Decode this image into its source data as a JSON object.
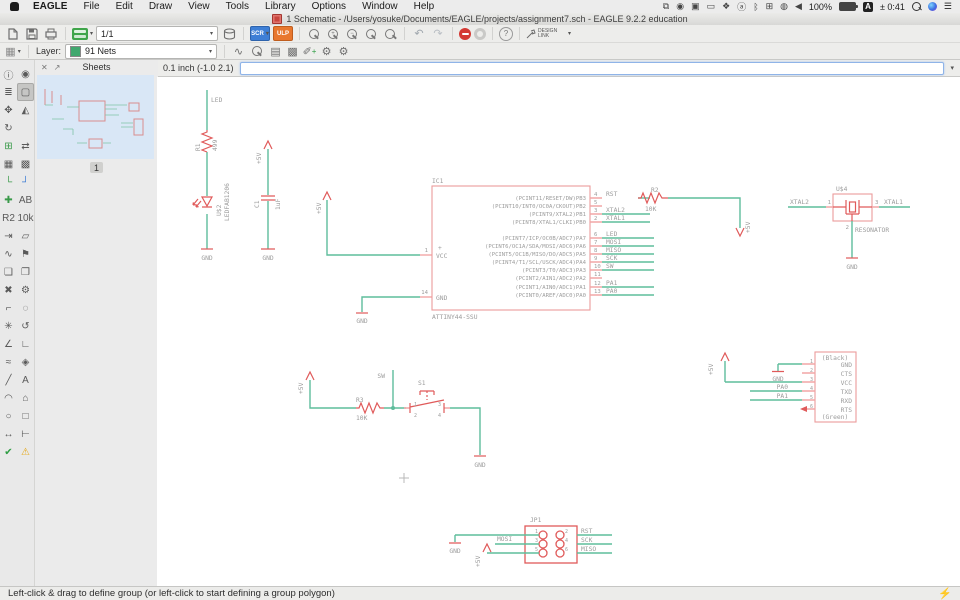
{
  "menu_bar": {
    "items": [
      "EAGLE",
      "File",
      "Edit",
      "Draw",
      "View",
      "Tools",
      "Library",
      "Options",
      "Window",
      "Help"
    ],
    "status_icons": [
      {
        "name": "display-mirroring-icon",
        "glyph": "⧉"
      },
      {
        "name": "camera-icon",
        "glyph": "◉"
      },
      {
        "name": "obs-icon",
        "glyph": "▣"
      },
      {
        "name": "monitor-icon",
        "glyph": "▭"
      },
      {
        "name": "dropbox-icon",
        "glyph": "❖"
      },
      {
        "name": "circled-a-icon",
        "glyph": "ⓐ"
      },
      {
        "name": "bluetooth-icon",
        "glyph": "ᛒ"
      },
      {
        "name": "window-manager-icon",
        "glyph": "⊞"
      },
      {
        "name": "screen-record-icon",
        "glyph": "◍"
      },
      {
        "name": "volume-icon",
        "glyph": "◀"
      }
    ],
    "battery_percent": "100%",
    "input_source": "A",
    "timer": "± 0:41",
    "notification_list_icon": "☰"
  },
  "title_bar": {
    "title": "1 Schematic - /Users/yosuke/Documents/EAGLE/projects/assignment7.sch - EAGLE 9.2.2 education"
  },
  "toolbar_main": {
    "sheet_selector": "1/1",
    "scr_label": "SCR",
    "ulp_label": "ULP",
    "zoom_in_glyph": "+",
    "zoom_out_glyph": "−",
    "undo_glyph": "↶",
    "redo_glyph": "↷",
    "help_label": "?",
    "design_link_label": "DESIGN LINK"
  },
  "toolbar_layer": {
    "label": "Layer:",
    "selected_layer": "91 Nets",
    "swatch_color": "#41A86F",
    "icons": [
      "∿",
      "▤",
      "▩",
      "✐",
      "⚙",
      "⚙"
    ]
  },
  "command_bar": {
    "grid_coords": "0.1 inch (-1.0 2.1)",
    "command_input_value": ""
  },
  "sheets_panel": {
    "title": "Sheets",
    "sheet_number": "1"
  },
  "palette": {
    "items": [
      {
        "n": "info-tool-icon",
        "g": "ⓘ"
      },
      {
        "n": "eye-show-tool-icon",
        "g": "◉"
      },
      {
        "n": "display-layers-tool-icon",
        "g": "≣"
      },
      {
        "n": "group-select-tool-icon",
        "g": "▢",
        "active": true
      },
      {
        "n": "move-tool-icon",
        "g": "✥"
      },
      {
        "n": "mirror-tool-icon",
        "g": "◭"
      },
      {
        "n": "rotate-tool-icon",
        "g": "↻"
      },
      {
        "n": "palette-spacer",
        "g": ""
      },
      {
        "n": "add-part-tool-icon",
        "g": "⊞",
        "c": "#3A9A4A"
      },
      {
        "n": "pinswap-tool-icon",
        "g": "⇄"
      },
      {
        "n": "replace-tool-icon",
        "g": "▦"
      },
      {
        "n": "gateswap-tool-icon",
        "g": "▩"
      },
      {
        "n": "wire-bend-1-tool-icon",
        "g": "└",
        "c": "#3A9A4A"
      },
      {
        "n": "wire-bend-2-tool-icon",
        "g": "┘",
        "c": "#3B7BD4"
      },
      {
        "n": "junction-tool-icon",
        "g": "✚",
        "c": "#3A9A4A"
      },
      {
        "n": "label-tool-icon",
        "g": "AB"
      },
      {
        "n": "name-tool-icon",
        "g": "R2"
      },
      {
        "n": "value-tool-icon",
        "g": "10k"
      },
      {
        "n": "invoke-tool-icon",
        "g": "⇥"
      },
      {
        "n": "polygon-tool-icon",
        "g": "▱"
      },
      {
        "n": "bus-tool-icon",
        "g": "∿"
      },
      {
        "n": "attribute-tool-icon",
        "g": "⚑"
      },
      {
        "n": "copy-tool-icon",
        "g": "❏"
      },
      {
        "n": "paste-tool-icon",
        "g": "❐"
      },
      {
        "n": "delete-tool-icon",
        "g": "✖"
      },
      {
        "n": "change-wrench-tool-icon",
        "g": "⚙"
      },
      {
        "n": "route-tool-icon",
        "g": "⌐"
      },
      {
        "n": "ripup-tool-icon",
        "g": "◌"
      },
      {
        "n": "smash-tool-icon",
        "g": "✳"
      },
      {
        "n": "copy-group-tool-icon",
        "g": "↺"
      },
      {
        "n": "split-tool-icon",
        "g": "∠"
      },
      {
        "n": "miter-tool-icon",
        "g": "∟"
      },
      {
        "n": "meander-tool-icon",
        "g": "≈"
      },
      {
        "n": "highlight-tool-icon",
        "g": "◈"
      },
      {
        "n": "line-tool-icon",
        "g": "╱"
      },
      {
        "n": "text-tool-icon",
        "g": "A"
      },
      {
        "n": "arc-tool-icon",
        "g": "◠"
      },
      {
        "n": "polygon-shape-tool-icon",
        "g": "⌂"
      },
      {
        "n": "circle-tool-icon",
        "g": "○"
      },
      {
        "n": "rect-tool-icon",
        "g": "□"
      },
      {
        "n": "dimension-tool-icon",
        "g": "↔"
      },
      {
        "n": "measure-tool-icon",
        "g": "⊢"
      },
      {
        "n": "erc-tool-icon",
        "g": "✔",
        "c": "#2F9E44"
      },
      {
        "n": "errors-tool-icon",
        "g": "⚠",
        "c": "#E6A817"
      }
    ]
  },
  "status_bar": {
    "hint": "Left-click & drag to define group (or left-click to start defining a group polygon)"
  },
  "schematic": {
    "colors": {
      "net": "#5FBD9C",
      "pin": "#F2A6A6",
      "symbol": "#E05A5A",
      "outline": "#EC9C9C",
      "label": "#9C9C9C"
    },
    "led_branch": {
      "net_label": "LED",
      "resistor_name": "R1",
      "resistor_value": "499",
      "led_name": "U$2",
      "led_value": "LEDFAB1206",
      "gnd": "GND"
    },
    "cap_branch": {
      "vcc": "+5V",
      "cap_name": "C1",
      "cap_value": "1uF",
      "gnd": "GND"
    },
    "vcc_feed": {
      "vcc": "+5V",
      "pin_num": "1"
    },
    "gnd_feed": {
      "gnd": "GND",
      "pin_num": "14"
    },
    "ic1": {
      "name": "IC1",
      "value": "ATTINY44-SSU",
      "plus": "+",
      "vcc_label": "VCC",
      "gnd_label": "GND",
      "pins": [
        {
          "num": "4",
          "label": "(PCINT11/RESET/DW)PB3",
          "net": "RST"
        },
        {
          "num": "5",
          "label": "(PCINT10/INT0/OC0A/CKOUT)PB2",
          "net": ""
        },
        {
          "num": "3",
          "label": "(PCINT9/XTAL2)PB1",
          "net": "XTAL2"
        },
        {
          "num": "2",
          "label": "(PCINT8/XTAL1/CLKI)PB0",
          "net": "XTAL1"
        },
        {
          "num": "6",
          "label": "(PCINT7/ICP/OC0B/ADC7)PA7",
          "net": "LED"
        },
        {
          "num": "7",
          "label": "(PCINT6/OC1A/SDA/MOSI/ADC6)PA6",
          "net": "MOSI"
        },
        {
          "num": "8",
          "label": "(PCINT5/OC1B/MISO/DO/ADC5)PA5",
          "net": "MISO"
        },
        {
          "num": "9",
          "label": "(PCINT4/T1/SCL/USCK/ADC4)PA4",
          "net": "SCK"
        },
        {
          "num": "10",
          "label": "(PCINT3/T0/ADC3)PA3",
          "net": "SW"
        },
        {
          "num": "11",
          "label": "(PCINT2/AIN1/ADC2)PA2",
          "net": ""
        },
        {
          "num": "12",
          "label": "(PCINT1/AIN0/ADC1)PA1",
          "net": "PA1"
        },
        {
          "num": "13",
          "label": "(PCINT0/AREF/ADC0)PA0",
          "net": "PA0"
        }
      ]
    },
    "r2": {
      "name": "R2",
      "value": "10K",
      "vcc": "+5V"
    },
    "resonator": {
      "name": "U$4",
      "value": "RESONATOR",
      "pin1": "1",
      "pin2": "2",
      "pin3": "3",
      "net_left": "XTAL2",
      "net_right": "XTAL1",
      "gnd": "GND"
    },
    "switch_circuit": {
      "vcc": "+5V",
      "resistor_name": "R3",
      "resistor_value": "10K",
      "net_label": "SW",
      "switch_name": "S1",
      "pin1": "1",
      "pin2": "2",
      "pin3": "3",
      "pin4": "4",
      "gnd": "GND"
    },
    "ftdi": {
      "top_note": "(Black)",
      "bottom_note": "(Green)",
      "gnd": "GND",
      "vcc": "+5V",
      "net_txd": "PA0",
      "net_rxd": "PA1",
      "pins": [
        {
          "num": "1",
          "name": "GND"
        },
        {
          "num": "2",
          "name": "CTS"
        },
        {
          "num": "3",
          "name": "VCC"
        },
        {
          "num": "4",
          "name": "TXD"
        },
        {
          "num": "5",
          "name": "RXD"
        },
        {
          "num": "6",
          "name": "RTS"
        }
      ]
    },
    "isp": {
      "name": "JP1",
      "net_gnd": "GND",
      "net_mosi": "MOSI",
      "vcc": "+5V",
      "net_rst": "RST",
      "net_sck": "SCK",
      "net_miso": "MISO",
      "pins": [
        "1",
        "2",
        "3",
        "4",
        "5",
        "6"
      ]
    }
  }
}
